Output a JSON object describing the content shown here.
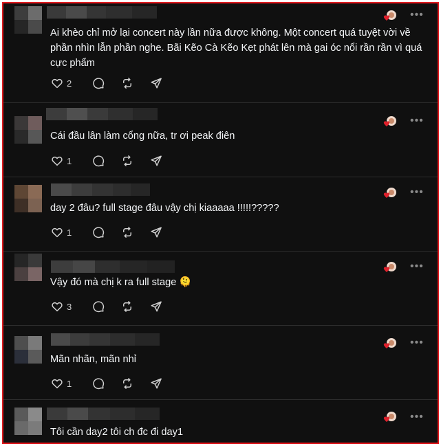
{
  "comments": [
    {
      "text": "Ai khèo chỉ mở lại concert này lần nữa được không. Một concert quá tuyệt vời về phần nhìn lẫn phần nghe. Bãi Kẽo Cà Kẽo Kẹt phát lên mà gai óc nổi rần rần vì quá cực phẩm",
      "likes": "2"
    },
    {
      "text": "Cái đầu lân làm cổng nữa, tr ơi peak điên",
      "likes": "1"
    },
    {
      "text": "day 2 đâu? full stage đâu vậy chị kiaaaaa !!!!!?????",
      "likes": "1"
    },
    {
      "text": "Vậy đó mà chị k ra full stage 🫠",
      "likes": "3"
    },
    {
      "text": "Mãn nhãn, mãn nhỉ",
      "likes": "1"
    },
    {
      "text": "Tôi cần day2 tôi ch đc đi day1",
      "likes": ""
    }
  ],
  "icons": {
    "like": "heart-icon",
    "reply": "comment-icon",
    "repost": "repost-icon",
    "share": "share-icon",
    "reaction": "reaction-icon",
    "more": "more-icon"
  },
  "more_glyph": "•••",
  "colors": {
    "background": "#101010",
    "text": "#f3f5f7",
    "icon": "#d0d0d0",
    "frame_border": "#e0191d",
    "reaction_heart": "#e0202b"
  }
}
